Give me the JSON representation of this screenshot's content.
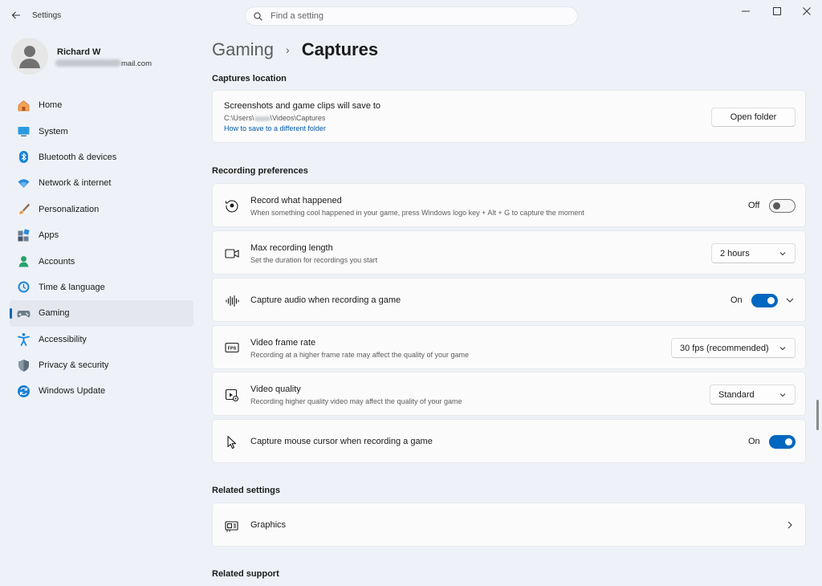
{
  "window": {
    "app_title": "Settings",
    "search_placeholder": "Find a setting"
  },
  "profile": {
    "name": "Richard W",
    "email_visible": "mail.com"
  },
  "sidebar": {
    "items": [
      {
        "label": "Home",
        "icon": "home-icon"
      },
      {
        "label": "System",
        "icon": "system-icon"
      },
      {
        "label": "Bluetooth & devices",
        "icon": "bluetooth-icon"
      },
      {
        "label": "Network & internet",
        "icon": "network-icon"
      },
      {
        "label": "Personalization",
        "icon": "brush-icon"
      },
      {
        "label": "Apps",
        "icon": "apps-icon"
      },
      {
        "label": "Accounts",
        "icon": "accounts-icon"
      },
      {
        "label": "Time & language",
        "icon": "time-language-icon"
      },
      {
        "label": "Gaming",
        "icon": "gaming-icon",
        "active": true
      },
      {
        "label": "Accessibility",
        "icon": "accessibility-icon"
      },
      {
        "label": "Privacy & security",
        "icon": "shield-icon"
      },
      {
        "label": "Windows Update",
        "icon": "windows-update-icon"
      }
    ]
  },
  "breadcrumb": {
    "parent": "Gaming",
    "separator": "›",
    "current": "Captures"
  },
  "captures_location": {
    "section_title": "Captures location",
    "title": "Screenshots and game clips will save to",
    "path_prefix": "C:\\Users\\",
    "path_suffix": "\\Videos\\Captures",
    "link": "How to save to a different folder",
    "open_folder_label": "Open folder"
  },
  "recording_preferences": {
    "section_title": "Recording preferences",
    "record_what_happened": {
      "title": "Record what happened",
      "desc": "When something cool happened in your game, press Windows logo key + Alt + G to capture the moment",
      "state_label": "Off"
    },
    "max_recording_length": {
      "title": "Max recording length",
      "desc": "Set the duration for recordings you start",
      "value": "2 hours"
    },
    "capture_audio": {
      "title": "Capture audio when recording a game",
      "state_label": "On"
    },
    "video_frame_rate": {
      "title": "Video frame rate",
      "desc": "Recording at a higher frame rate may affect the quality of your game",
      "value": "30 fps (recommended)"
    },
    "video_quality": {
      "title": "Video quality",
      "desc": "Recording higher quality video may affect the quality of your game",
      "value": "Standard"
    },
    "capture_mouse_cursor": {
      "title": "Capture mouse cursor when recording a game",
      "state_label": "On"
    }
  },
  "related_settings": {
    "section_title": "Related settings",
    "graphics": {
      "title": "Graphics"
    }
  },
  "related_support": {
    "section_title": "Related support"
  },
  "colors": {
    "accent": "#0067c0",
    "background": "#eef2f8",
    "card": "#fbfbfc"
  }
}
